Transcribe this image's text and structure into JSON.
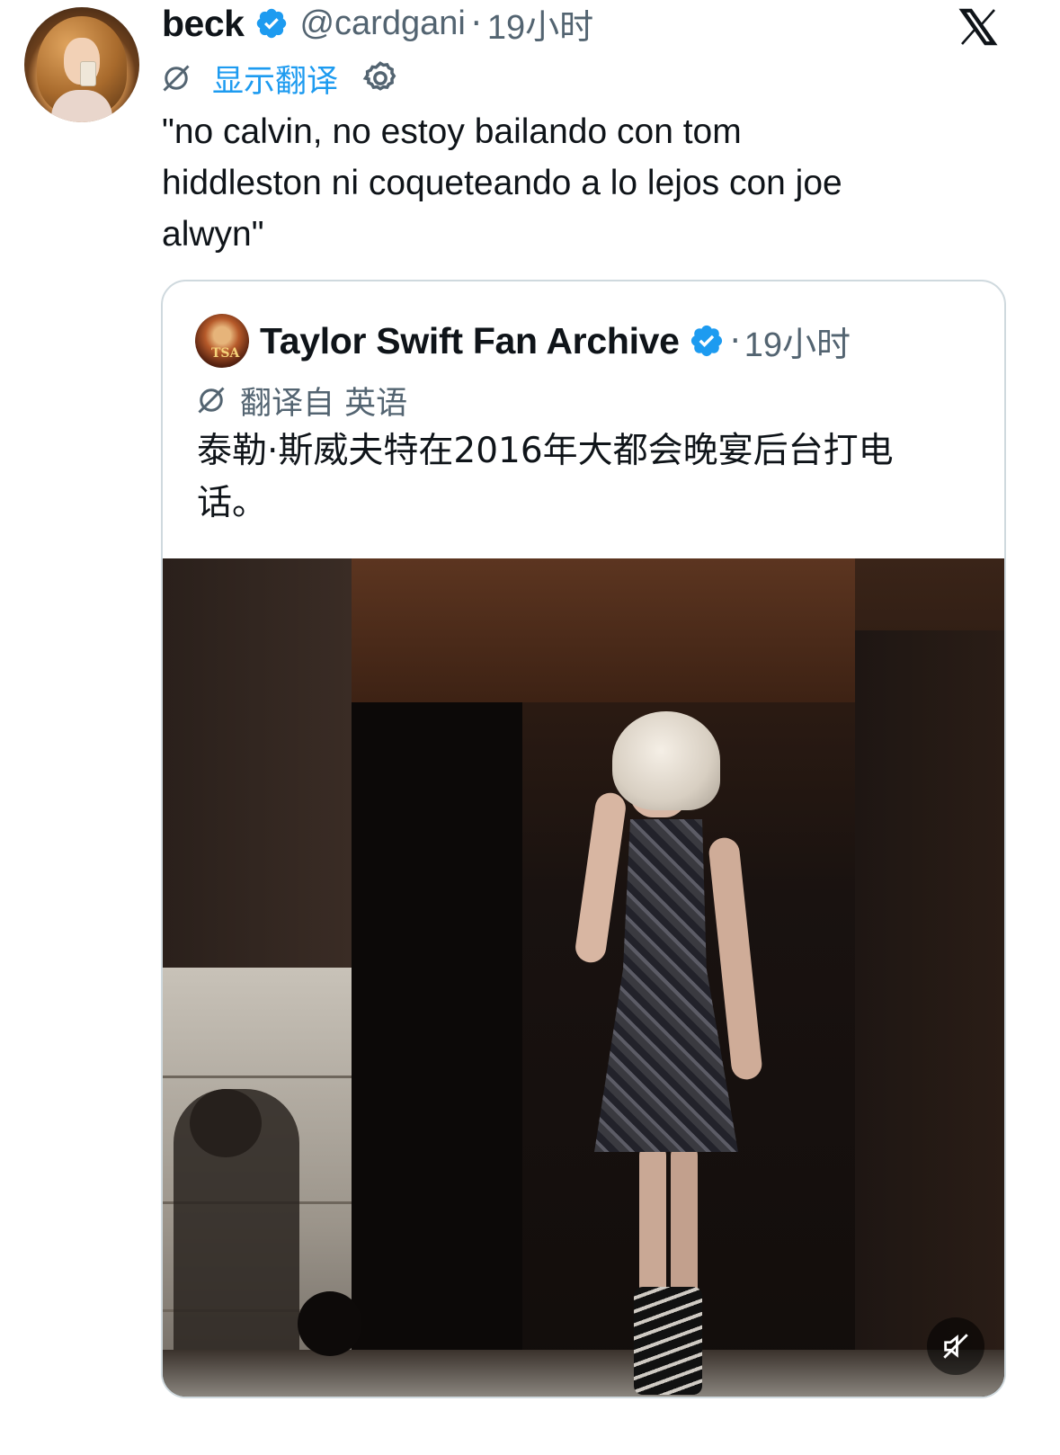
{
  "tweet": {
    "author_name": "beck",
    "author_handle": "@cardgani",
    "separator": "·",
    "time": "19小时",
    "translate_link": "显示翻译",
    "text": "\"no calvin, no estoy bailando con tom\nhiddleston ni coqueteando a lo lejos con joe\nalwyn\""
  },
  "quoted": {
    "author_name": "Taylor Swift Fan Archive",
    "avatar_text": "TSA",
    "separator": "·",
    "time": "19小时",
    "translated_from": "翻译自 英语",
    "text": "泰勒·斯威夫特在2016年大都会晚宴后台打电\n话。"
  },
  "icons": {
    "verified": "verified-badge-icon",
    "x_logo": "x-logo-icon",
    "translate": "translate-icon",
    "settings": "gear-icon",
    "mute": "mute-icon"
  },
  "colors": {
    "accent": "#1d9bf0",
    "secondary_text": "#536471",
    "border": "#cfd9de"
  }
}
